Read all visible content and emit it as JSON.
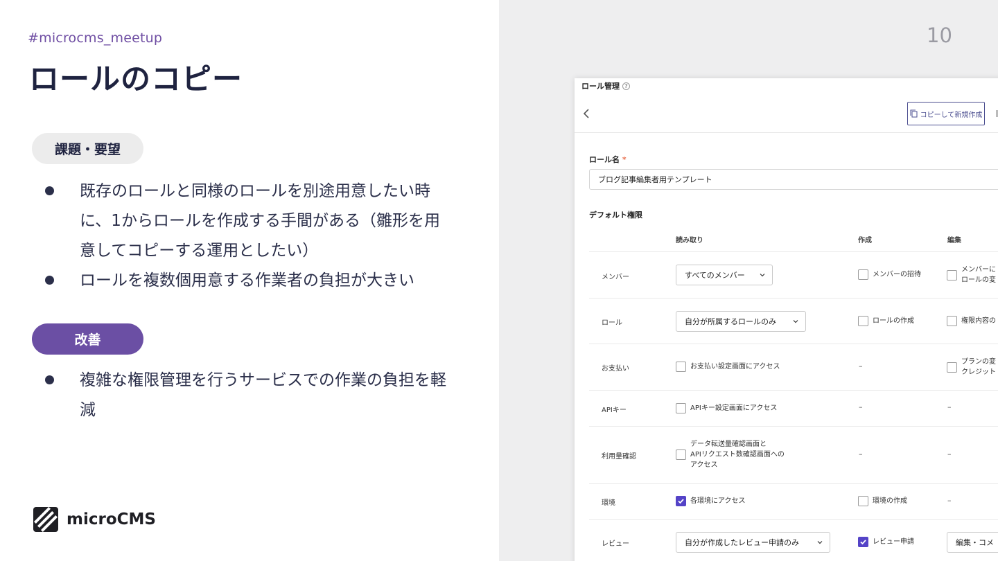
{
  "slide": {
    "hashtag": "#microcms_meetup",
    "title": "ロールのコピー",
    "issue_label": "課題・要望",
    "issue_bullets": [
      "既存のロールと同様のロールを別途用意したい時に、1からロールを作成する手間がある（雛形を用意してコピーする運用としたい）",
      "ロールを複数個用意する作業者の負担が大きい"
    ],
    "improve_label": "改善",
    "improve_bullets": [
      "複雑な権限管理を行うサービスでの作業の負担を軽減"
    ],
    "brand": "microCMS",
    "page_number": "10"
  },
  "screen": {
    "breadcrumb": "ロール管理",
    "help_glyph": "?",
    "copy_button": "コピーして新規作成",
    "role_name_label": "ロール名",
    "required_mark": "*",
    "role_name_value": "ブログ記事編集者用テンプレート",
    "default_permissions_label": "デフォルト権限",
    "columns": {
      "read": "読み取り",
      "create": "作成",
      "edit": "編集"
    },
    "rows": {
      "member": {
        "label": "メンバー",
        "read": "すべてのメンバー",
        "create": "メンバーの招待",
        "edit_1": "メンバーに",
        "edit_2": "ロールの変"
      },
      "role": {
        "label": "ロール",
        "read": "自分が所属するロールのみ",
        "create": "ロールの作成",
        "edit": "権限内容の"
      },
      "payment": {
        "label": "お支払い",
        "read": "お支払い設定画面にアクセス",
        "create": "–",
        "edit_1": "プランの変",
        "edit_2": "クレジット"
      },
      "apikey": {
        "label": "APIキー",
        "read": "APIキー設定画面にアクセス",
        "create": "–",
        "edit": "–"
      },
      "usage": {
        "label": "利用量確認",
        "read_1": "データ転送量確認画面と",
        "read_2": "APIリクエスト数確認画面への",
        "read_3": "アクセス",
        "create": "–",
        "edit": "–"
      },
      "env": {
        "label": "環境",
        "read": "各環境にアクセス",
        "read_checked": true,
        "create": "環境の作成",
        "edit": "–"
      },
      "review": {
        "label": "レビュー",
        "read": "自分が作成したレビュー申請のみ",
        "create": "レビュー申請",
        "create_checked": true,
        "edit": "編集・コメ"
      }
    },
    "accent_color": "#5443c7"
  }
}
